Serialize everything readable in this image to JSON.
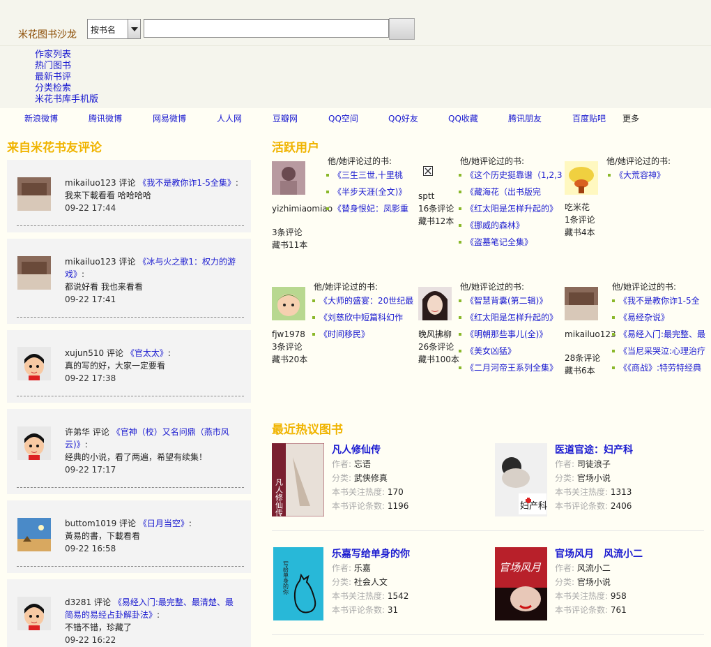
{
  "header": {
    "logo": "米花图书沙龙",
    "search_select": "按书名",
    "search_value": "",
    "nav": [
      "作家列表",
      "热门图书",
      "最新书评",
      "分类检索",
      "米花书库手机版"
    ]
  },
  "share": [
    "新浪微博",
    "腾讯微博",
    "网易微博",
    "人人网",
    "豆瓣网",
    "QQ空间",
    "QQ好友",
    "QQ收藏",
    "腾讯朋友",
    "百度贴吧",
    "更多"
  ],
  "left": {
    "title": "来自米花书友评论",
    "comments": [
      {
        "user": "mikailuo123",
        "action": "评论",
        "book": "《我不是教你诈1-5全集》",
        "colon": ":",
        "text": "我来下載看看 哈哈哈哈",
        "time": "09-22 17:44"
      },
      {
        "user": "mikailuo123",
        "action": "评论",
        "book": "《冰与火之歌1：权力的游戏》",
        "colon": ":",
        "text": "都说好看 我也来看看",
        "time": "09-22 17:41"
      },
      {
        "user": "xujun510",
        "action": "评论",
        "book": "《官太太》",
        "colon": ":",
        "text": "真的写的好，大家一定要看",
        "time": "09-22 17:38"
      },
      {
        "user": "许弟华",
        "action": "评论",
        "book": "《官神（校）又名问鼎（燕市风云)》",
        "colon": ":",
        "text": "经典的小说，看了两遍，希望有续集！",
        "time": "09-22 17:17"
      },
      {
        "user": "buttom1019",
        "action": "评论",
        "book": "《日月当空》",
        "colon": ":",
        "text": "黃易的書，下載看看",
        "time": "09-22 16:58"
      },
      {
        "user": "d3281",
        "action": "评论",
        "book": "《易经入门:最完整、最清楚、最简易的易经占卦解卦法》",
        "colon": ":",
        "text": "不错不错，珍藏了",
        "time": "09-22 16:22"
      }
    ]
  },
  "active": {
    "title": "活跃用户",
    "reviewed_label": "他/她评论过的书:",
    "users": [
      {
        "name": "yizhimiaomiao",
        "reviews": "3条评论",
        "collections": "藏书11本",
        "books": [
          "《三生三世,十里桃",
          "《半步天涯(全文)》",
          "《替身恨妃：凤影重"
        ]
      },
      {
        "name": "sptt",
        "reviews": "16条评论",
        "collections": "藏书12本",
        "books": [
          "《这个历史挺靠谱（1,2,3",
          "《藏海花（出书版完",
          "《红太阳是怎样升起的》",
          "《挪威的森林》",
          "《盗墓笔记全集》"
        ]
      },
      {
        "name": "吃米花",
        "reviews": "1条评论",
        "collections": "藏书4本",
        "books": [
          "《大荒容神》"
        ]
      },
      {
        "name": "fjw1978",
        "reviews": "3条评论",
        "collections": "藏书20本",
        "books": [
          "《大师的盛宴：20世纪最",
          "《刘慈欣中短篇科幻作",
          "《时间移民》"
        ]
      },
      {
        "name": "晚风拂柳",
        "reviews": "26条评论",
        "collections": "藏书100本",
        "books": [
          "《智慧背囊(第二辑)》",
          "《红太阳是怎样升起的》",
          "《明朝那些事儿(全)》",
          "《美女凶猛》",
          "《二月河帝王系列全集》"
        ]
      },
      {
        "name": "mikailuo123",
        "reviews": "28条评论",
        "collections": "藏书6本",
        "books": [
          "《我不是教你诈1-5全",
          "《易经杂说》",
          "《易经入门:最完整、最",
          "《当尼采哭泣:心理治疗",
          "《《商战》:特劳特经典"
        ]
      }
    ]
  },
  "hot": {
    "title": "最近热议图书",
    "labels": {
      "author": "作者:",
      "category": "分类:",
      "heat": "本书关注热度:",
      "reviews": "本书评论条数:"
    },
    "books": [
      {
        "title": "凡人修仙传",
        "author": "忘语",
        "category": "武侠修真",
        "heat": "170",
        "reviews": "1196",
        "cover_text": "凡人修仙传"
      },
      {
        "title": "医道官途：妇产科",
        "author": "司徒浪子",
        "category": "官场小说",
        "heat": "1313",
        "reviews": "2406",
        "cover_text": "妇产科"
      },
      {
        "title": "乐嘉写给单身的你",
        "author": "乐嘉",
        "category": "社会人文",
        "heat": "1542",
        "reviews": "31",
        "cover_text": "写给单身的你"
      },
      {
        "title": "官场风月　风流小二",
        "author": "风流小二",
        "category": "官场小说",
        "heat": "958",
        "reviews": "761",
        "cover_text": "官场风月"
      }
    ]
  },
  "colors": {
    "accent": "#f0b400",
    "link": "#1a1ad0",
    "card_bg": "#f3f3f3",
    "header_bg": "#f5f5ed",
    "page_bg": "#fffef4"
  }
}
